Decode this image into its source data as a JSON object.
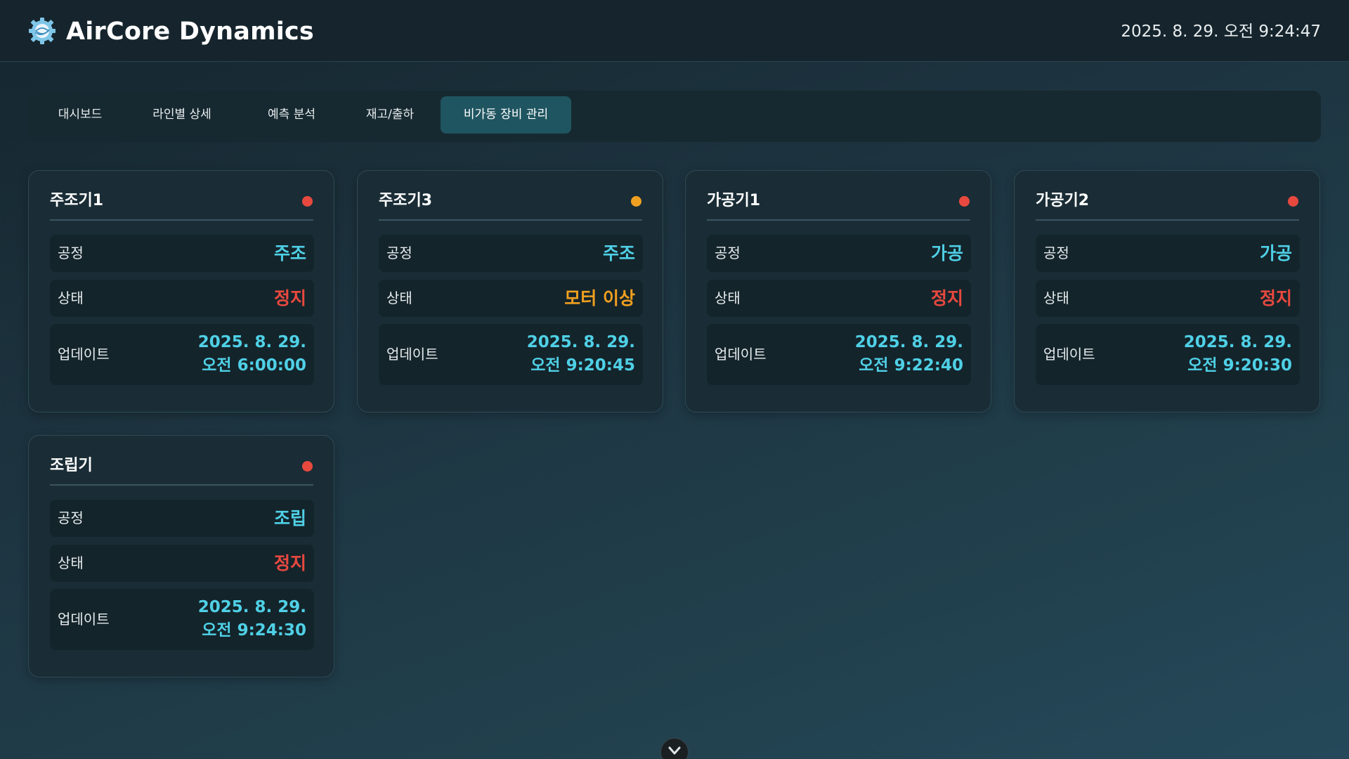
{
  "app": {
    "title": "AirCore Dynamics",
    "logo_icon": "gear-globe-icon",
    "clock": "2025. 8. 29. 오전 9:24:47"
  },
  "nav": {
    "tabs": [
      {
        "label": "대시보드"
      },
      {
        "label": "라인별 상세"
      },
      {
        "label": "예측 분석"
      },
      {
        "label": "재고/출하"
      },
      {
        "label": "비가동 장비 관리",
        "active": true
      }
    ]
  },
  "labels": {
    "process": "공정",
    "status": "상태",
    "updated": "업데이트"
  },
  "colors": {
    "accent": "#4fd0e6",
    "stopped": "#e8493f",
    "warning": "#f0a020"
  },
  "machines": [
    {
      "name": "주조기1",
      "dot_color": "#e8493f",
      "process": "주조",
      "status": "정지",
      "status_color": "#e8493f",
      "updated_date": "2025. 8. 29.",
      "updated_time": "오전 6:00:00"
    },
    {
      "name": "주조기3",
      "dot_color": "#f0a020",
      "process": "주조",
      "status": "모터 이상",
      "status_color": "#f0a020",
      "updated_date": "2025. 8. 29.",
      "updated_time": "오전 9:20:45"
    },
    {
      "name": "가공기1",
      "dot_color": "#e8493f",
      "process": "가공",
      "status": "정지",
      "status_color": "#e8493f",
      "updated_date": "2025. 8. 29.",
      "updated_time": "오전 9:22:40"
    },
    {
      "name": "가공기2",
      "dot_color": "#e8493f",
      "process": "가공",
      "status": "정지",
      "status_color": "#e8493f",
      "updated_date": "2025. 8. 29.",
      "updated_time": "오전 9:20:30"
    },
    {
      "name": "조립기",
      "dot_color": "#e8493f",
      "process": "조립",
      "status": "정지",
      "status_color": "#e8493f",
      "updated_date": "2025. 8. 29.",
      "updated_time": "오전 9:24:30"
    }
  ],
  "scroll_icon": "chevron-down-icon"
}
